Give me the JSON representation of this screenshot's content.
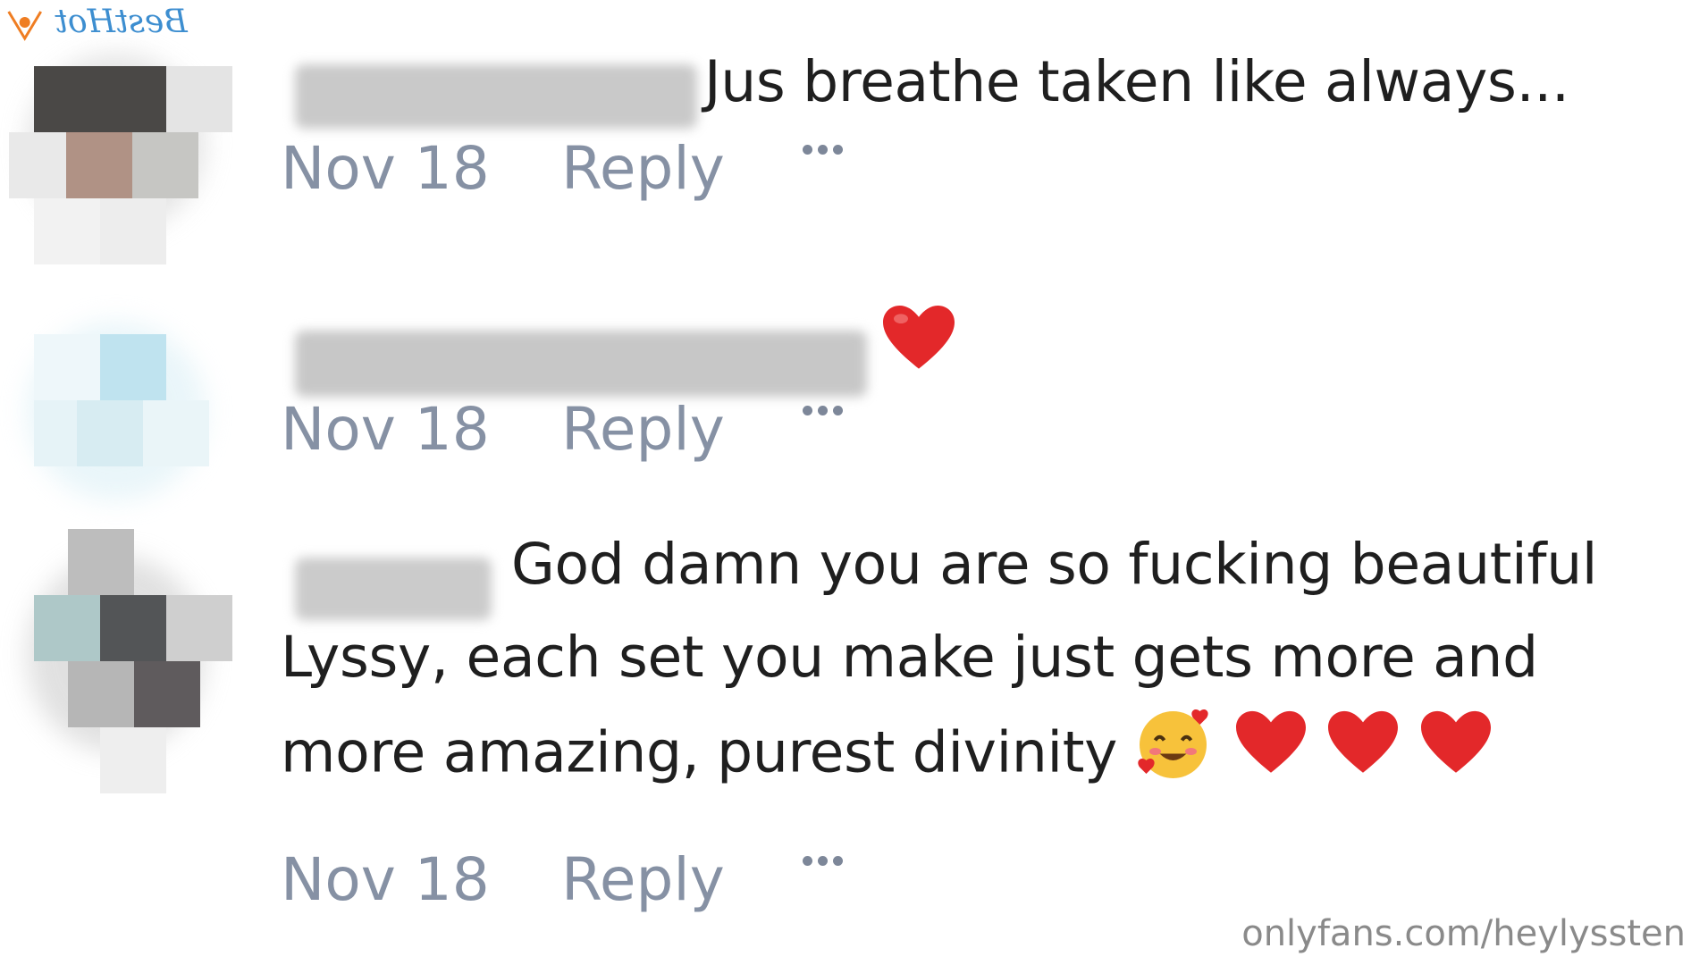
{
  "watermark_top": "BestHot",
  "watermark_bottom": "onlyfans.com/heylyssten",
  "comments": [
    {
      "text": "Jus breathe taken like always...",
      "date": "Nov 18",
      "reply_label": "Reply"
    },
    {
      "text": "❤️",
      "date": "Nov 18",
      "reply_label": "Reply"
    },
    {
      "text_line1": "God damn you are so fucking beautiful",
      "text_line2": "Lyssy, each set you make just gets more and",
      "text_line3": "more amazing, purest divinity",
      "date": "Nov 18",
      "reply_label": "Reply"
    }
  ],
  "icons": {
    "more": "more-options-icon",
    "heart": "red-heart-icon",
    "hug": "smiling-face-with-hearts-icon"
  },
  "colors": {
    "meta": "#8691a4",
    "text": "#1f1f1f",
    "heart": "#e3282a",
    "watermark_top": "#3d8ed0"
  }
}
